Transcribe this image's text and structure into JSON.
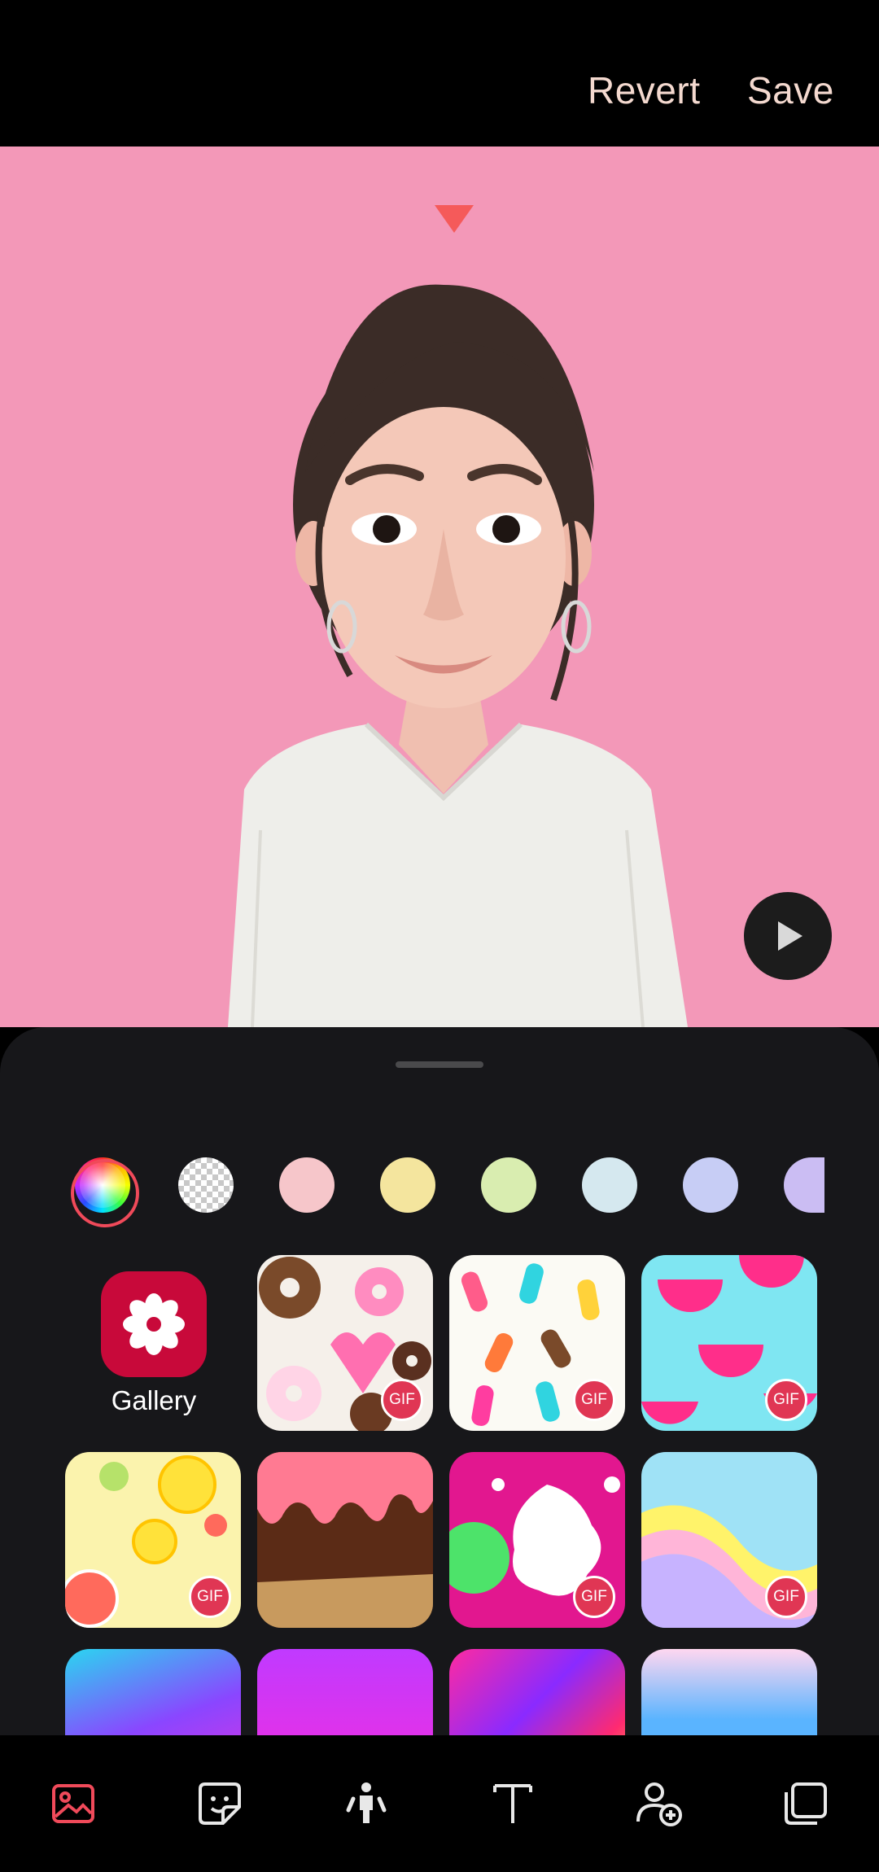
{
  "header": {
    "revert_label": "Revert",
    "save_label": "Save"
  },
  "canvas": {
    "background_color": "#f398b8",
    "play_icon": "play-icon",
    "marker_icon": "triangle-marker-icon"
  },
  "colors": {
    "swatches": [
      "color-picker",
      "transparent",
      "#f6c6ca",
      "#f4e59e",
      "#d9edb0",
      "#d5e8ef",
      "#c7cdf5",
      "#cbbdf3"
    ],
    "accent": "#f04a5a"
  },
  "backgrounds": {
    "gallery_label": "Gallery",
    "gif_label": "GIF",
    "tiles": [
      {
        "name": "donuts",
        "gif": true
      },
      {
        "name": "popsicles",
        "gif": true
      },
      {
        "name": "watermelon",
        "gif": true
      },
      {
        "name": "lemons",
        "gif": true
      },
      {
        "name": "chocolate-drip",
        "gif": true
      },
      {
        "name": "paint-splash",
        "gif": true
      },
      {
        "name": "rainbow-waves",
        "gif": true
      },
      {
        "name": "bubbles",
        "gif": false
      },
      {
        "name": "sparkles",
        "gif": false
      },
      {
        "name": "neon-streaks",
        "gif": false
      },
      {
        "name": "sky-clouds",
        "gif": false
      }
    ]
  },
  "bottom_nav": [
    "background-icon",
    "sticker-icon",
    "pose-icon",
    "text-icon",
    "add-person-icon",
    "layers-icon"
  ]
}
